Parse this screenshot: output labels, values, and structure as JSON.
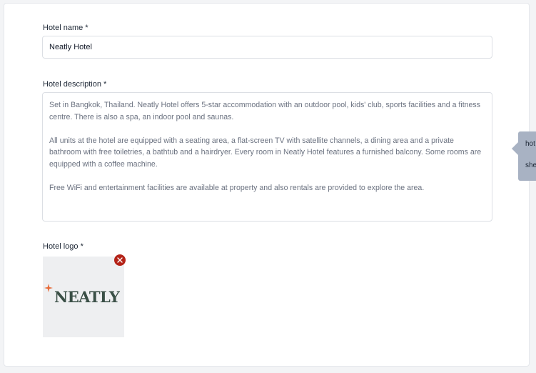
{
  "form": {
    "name_label": "Hotel name *",
    "name_value": "Neatly Hotel",
    "description_label": "Hotel description *",
    "description_paragraphs": [
      "Set in Bangkok, Thailand. Neatly Hotel offers 5-star accommodation with an outdoor pool, kids' club, sports facilities and a fitness centre. There is also a spa, an indoor pool and saunas.",
      "All units at the hotel are equipped with a seating area, a flat-screen TV with satellite channels, a dining area and a private bathroom with free toiletries, a bathtub and a hairdryer. Every room in Neatly Hotel features a furnished balcony. Some rooms are equipped with a coffee machine.",
      "Free WiFi and entertainment facilities are available at property and also rentals are provided to explore the area."
    ],
    "logo_label": "Hotel logo *",
    "logo_text": "NEATLY",
    "remove_icon": "close-icon"
  },
  "tooltip": {
    "line1": "hot",
    "line2": "she"
  },
  "colors": {
    "remove_button": "#b42318",
    "logo_text": "#3a4f46",
    "logo_star": "#e76b39",
    "tooltip_bg": "#a8b2c3"
  }
}
